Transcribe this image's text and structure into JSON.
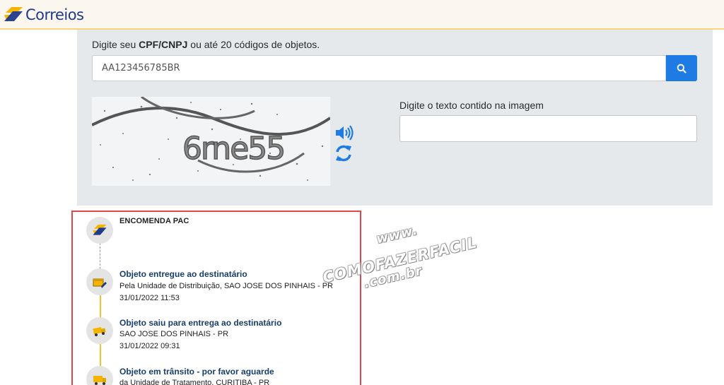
{
  "header": {
    "brand_name": "Correios",
    "colors": {
      "logo_yellow": "#f5b400",
      "logo_blue": "#1f3a8a",
      "header_bg": "#fbf7ef"
    }
  },
  "search": {
    "instruction_prefix": "Digite seu ",
    "instruction_bold": "CPF/CNPJ",
    "instruction_suffix": " ou até 20 códigos de objetos.",
    "code_value": "AA123456785BR",
    "button_icon": "search-icon",
    "button_color": "#1d7be3"
  },
  "captcha": {
    "image_text": "6rne55",
    "audio_icon": "speaker-icon",
    "refresh_icon": "refresh-icon",
    "label": "Digite o texto contido na imagem",
    "value": ""
  },
  "tracking": {
    "service": "ENCOMENDA PAC",
    "events": [
      {
        "title": "Objeto entregue ao destinatário",
        "detail": "Pela Unidade de Distribuição, SAO JOSE DOS PINHAIS - PR",
        "datetime": "31/01/2022 11:53",
        "icon": "delivered-package-icon"
      },
      {
        "title": "Objeto saiu para entrega ao destinatário",
        "detail": "SAO JOSE DOS PINHAIS - PR",
        "datetime": "31/01/2022 09:31",
        "icon": "delivery-truck-icon"
      },
      {
        "title": "Objeto em trânsito - por favor aguarde",
        "detail": "da Unidade de Tratamento, CURITIBA - PR",
        "icon": "transit-truck-icon"
      }
    ],
    "timeline_color": "#f1c232",
    "highlight_color": "#e0474c"
  },
  "watermark": {
    "line1": "www.",
    "line2": "COMOFAZERFACIL",
    "line3": ".com.br"
  }
}
